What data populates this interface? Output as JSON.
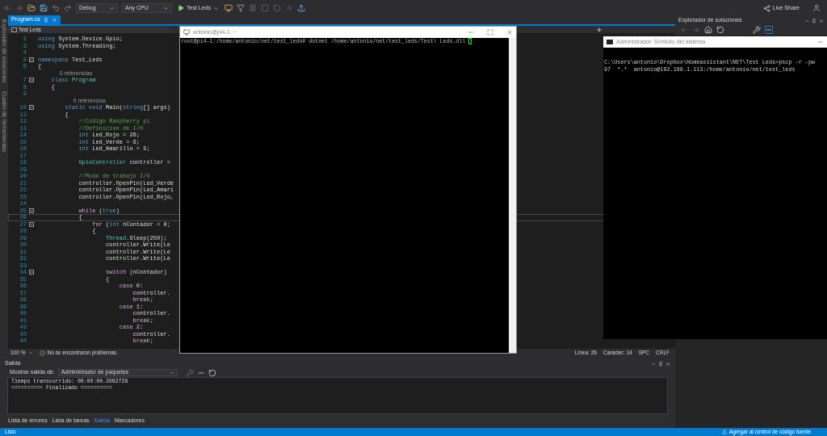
{
  "toolbar": {
    "configuration": "Debug",
    "platform": "Any CPU",
    "run_target": "Test Leds",
    "live_share": "Live Share"
  },
  "side_tabs": [
    {
      "label": "Explorador de soluciones"
    },
    {
      "label": "Cuadro de herramientas"
    }
  ],
  "editor": {
    "tab": {
      "label": "Program.cs",
      "selected": true
    },
    "nav_project": "Test Leds",
    "lines": [
      {
        "kind": "code",
        "number": "2",
        "current": false,
        "fold": false,
        "tokens": [
          {
            "kind": "kw",
            "text": "using"
          },
          {
            "kind": "txt",
            "text": " System.Device.Gpio;"
          }
        ]
      },
      {
        "kind": "code",
        "number": "3",
        "current": false,
        "fold": false,
        "tokens": [
          {
            "kind": "kw",
            "text": "using"
          },
          {
            "kind": "txt",
            "text": " System.Threading;"
          }
        ]
      },
      {
        "kind": "code",
        "number": "4",
        "current": false,
        "fold": false
      },
      {
        "kind": "code",
        "number": "5",
        "current": false,
        "fold": true,
        "tokens": [
          {
            "kind": "kw",
            "text": "namespace"
          },
          {
            "kind": "txt",
            "text": " Test_Leds"
          }
        ]
      },
      {
        "kind": "code",
        "number": "6",
        "current": false,
        "fold": false,
        "tokens": [
          {
            "kind": "txt",
            "text": "{"
          }
        ]
      },
      {
        "kind": "codelens",
        "text": "0 referencias"
      },
      {
        "kind": "code",
        "number": "7",
        "current": false,
        "fold": true,
        "tokens": [
          {
            "kind": "kw",
            "text": "    class"
          },
          {
            "kind": "type",
            "text": " Program"
          }
        ]
      },
      {
        "kind": "code",
        "number": "8",
        "current": false,
        "fold": false,
        "tokens": [
          {
            "kind": "txt",
            "text": "    {"
          }
        ]
      },
      {
        "kind": "code",
        "number": "9",
        "current": false,
        "fold": false
      },
      {
        "kind": "codelens",
        "text": "0 referencias"
      },
      {
        "kind": "code",
        "number": "10",
        "current": false,
        "fold": true,
        "tokens": [
          {
            "kind": "kw",
            "text": "        static void"
          },
          {
            "kind": "txt",
            "text": " Main("
          },
          {
            "kind": "kw",
            "text": "string"
          },
          {
            "kind": "txt",
            "text": "[] args)"
          }
        ]
      },
      {
        "kind": "code",
        "number": "11",
        "current": false,
        "fold": false,
        "tokens": [
          {
            "kind": "txt",
            "text": "        {"
          }
        ]
      },
      {
        "kind": "code",
        "number": "12",
        "current": false,
        "fold": false,
        "tokens": [
          {
            "kind": "cmt",
            "text": "            //Codigo Raspberry pi"
          }
        ]
      },
      {
        "kind": "code",
        "number": "13",
        "current": false,
        "fold": false,
        "tokens": [
          {
            "kind": "cmt",
            "text": "            //Definicion de I/O"
          }
        ]
      },
      {
        "kind": "code",
        "number": "14",
        "current": false,
        "fold": false,
        "tokens": [
          {
            "kind": "kw",
            "text": "            int"
          },
          {
            "kind": "txt",
            "text": " Led_Rojo = 26;"
          }
        ]
      },
      {
        "kind": "code",
        "number": "15",
        "current": false,
        "fold": false,
        "tokens": [
          {
            "kind": "kw",
            "text": "            int"
          },
          {
            "kind": "txt",
            "text": " Led_Verde = 6;"
          }
        ]
      },
      {
        "kind": "code",
        "number": "16",
        "current": false,
        "fold": false,
        "tokens": [
          {
            "kind": "kw",
            "text": "            int"
          },
          {
            "kind": "txt",
            "text": " Led_Amarillo = 5;"
          }
        ]
      },
      {
        "kind": "code",
        "number": "17",
        "current": false,
        "fold": false
      },
      {
        "kind": "code",
        "number": "18",
        "current": false,
        "fold": false,
        "tokens": [
          {
            "kind": "type",
            "text": "            GpioController"
          },
          {
            "kind": "txt",
            "text": " controller ="
          }
        ]
      },
      {
        "kind": "code",
        "number": "19",
        "current": false,
        "fold": false
      },
      {
        "kind": "code",
        "number": "20",
        "current": false,
        "fold": false,
        "tokens": [
          {
            "kind": "cmt",
            "text": "            //Modo de trabajo I/O"
          }
        ]
      },
      {
        "kind": "code",
        "number": "21",
        "current": false,
        "fold": false,
        "tokens": [
          {
            "kind": "txt",
            "text": "            controller.OpenPin(Led_Verde"
          }
        ]
      },
      {
        "kind": "code",
        "number": "22",
        "current": false,
        "fold": false,
        "tokens": [
          {
            "kind": "txt",
            "text": "            controller.OpenPin(Led_Amari"
          }
        ]
      },
      {
        "kind": "code",
        "number": "23",
        "current": false,
        "fold": false,
        "tokens": [
          {
            "kind": "txt",
            "text": "            controller.OpenPin(Led_Rojo,"
          }
        ]
      },
      {
        "kind": "code",
        "number": "24",
        "current": false,
        "fold": false
      },
      {
        "kind": "code",
        "number": "25",
        "current": false,
        "fold": true,
        "tokens": [
          {
            "kind": "ctl",
            "text": "            while"
          },
          {
            "kind": "txt",
            "text": " ("
          },
          {
            "kind": "kw",
            "text": "true"
          },
          {
            "kind": "txt",
            "text": ")"
          }
        ]
      },
      {
        "kind": "code",
        "number": "26",
        "current": true,
        "fold": false,
        "tokens": [
          {
            "kind": "txt",
            "text": "            {"
          }
        ]
      },
      {
        "kind": "code",
        "number": "27",
        "current": false,
        "fold": true,
        "tokens": [
          {
            "kind": "ctl",
            "text": "                for"
          },
          {
            "kind": "txt",
            "text": " ("
          },
          {
            "kind": "kw",
            "text": "int"
          },
          {
            "kind": "txt",
            "text": " nContador = 0;"
          }
        ]
      },
      {
        "kind": "code",
        "number": "28",
        "current": false,
        "fold": false,
        "tokens": [
          {
            "kind": "txt",
            "text": "                {"
          }
        ]
      },
      {
        "kind": "code",
        "number": "29",
        "current": false,
        "fold": false,
        "tokens": [
          {
            "kind": "type",
            "text": "                    Thread"
          },
          {
            "kind": "txt",
            "text": ".Sleep(250);"
          }
        ]
      },
      {
        "kind": "code",
        "number": "30",
        "current": false,
        "fold": false,
        "tokens": [
          {
            "kind": "txt",
            "text": "                    controller.Write(Le"
          }
        ]
      },
      {
        "kind": "code",
        "number": "31",
        "current": false,
        "fold": false,
        "tokens": [
          {
            "kind": "txt",
            "text": "                    controller.Write(Le"
          }
        ]
      },
      {
        "kind": "code",
        "number": "32",
        "current": false,
        "fold": false,
        "tokens": [
          {
            "kind": "txt",
            "text": "                    controller.Write(Le"
          }
        ]
      },
      {
        "kind": "code",
        "number": "33",
        "current": false,
        "fold": false
      },
      {
        "kind": "code",
        "number": "34",
        "current": false,
        "fold": true,
        "tokens": [
          {
            "kind": "ctl",
            "text": "                    switch"
          },
          {
            "kind": "txt",
            "text": " (nContador)"
          }
        ]
      },
      {
        "kind": "code",
        "number": "35",
        "current": false,
        "fold": false,
        "tokens": [
          {
            "kind": "txt",
            "text": "                    {"
          }
        ]
      },
      {
        "kind": "code",
        "number": "36",
        "current": false,
        "fold": false,
        "tokens": [
          {
            "kind": "ctl",
            "text": "                        case"
          },
          {
            "kind": "txt",
            "text": " 0:"
          }
        ]
      },
      {
        "kind": "code",
        "number": "37",
        "current": false,
        "fold": false,
        "tokens": [
          {
            "kind": "txt",
            "text": "                            controller."
          }
        ]
      },
      {
        "kind": "code",
        "number": "38",
        "current": false,
        "fold": false,
        "tokens": [
          {
            "kind": "ctl",
            "text": "                            break"
          },
          {
            "kind": "txt",
            "text": ";"
          }
        ]
      },
      {
        "kind": "code",
        "number": "39",
        "current": false,
        "fold": false,
        "tokens": [
          {
            "kind": "ctl",
            "text": "                        case"
          },
          {
            "kind": "txt",
            "text": " 1:"
          }
        ]
      },
      {
        "kind": "code",
        "number": "40",
        "current": false,
        "fold": false,
        "tokens": [
          {
            "kind": "txt",
            "text": "                            controller."
          }
        ]
      },
      {
        "kind": "code",
        "number": "41",
        "current": false,
        "fold": false,
        "tokens": [
          {
            "kind": "ctl",
            "text": "                            break"
          },
          {
            "kind": "txt",
            "text": ";"
          }
        ]
      },
      {
        "kind": "code",
        "number": "42",
        "current": false,
        "fold": false,
        "tokens": [
          {
            "kind": "ctl",
            "text": "                        case"
          },
          {
            "kind": "txt",
            "text": " 2:"
          }
        ]
      },
      {
        "kind": "code",
        "number": "43",
        "current": false,
        "fold": false,
        "tokens": [
          {
            "kind": "txt",
            "text": "                            controller."
          }
        ]
      },
      {
        "kind": "code",
        "number": "44",
        "current": false,
        "fold": false,
        "tokens": [
          {
            "kind": "ctl",
            "text": "                            break"
          },
          {
            "kind": "txt",
            "text": ";"
          }
        ]
      }
    ],
    "status": {
      "zoom": "100 %",
      "issues": "No se encontraron problemas.",
      "line": "Línea: 26",
      "column": "Carácter: 14",
      "whitespace": "SPC",
      "line_endings": "CRLF"
    }
  },
  "putty": {
    "title": "antonio@pi4-1: ~",
    "prompt": "root@pi4-1:/home/antonio/net/test_leds# dotnet /home/antonio/net/test_leds/Test\\ Leds.dll"
  },
  "cmd": {
    "title": "Administrador: Símbolo del sistema",
    "lines": [
      "C:\\Users\\antonio\\Dropbox\\Homeassistant\\NET\\Test Leds>pscp -r -pw",
      "97  *.*  antonio@192.168.1.113:/home/antonio/net/test_leds"
    ]
  },
  "solution_explorer": {
    "title": "Explorador de soluciones"
  },
  "output": {
    "title": "Salida",
    "source_label": "Mostrar salida de:",
    "source": "Administrador de paquetes",
    "lines": [
      "Tiempo transcurrido: 00:00:00.3062728",
      "========== Finalizado =========="
    ],
    "tabs": [
      {
        "label": "Lista de errores",
        "selected": false
      },
      {
        "label": "Lista de tareas",
        "selected": false
      },
      {
        "label": "Salida",
        "selected": true
      },
      {
        "label": "Marcadores",
        "selected": false
      }
    ]
  },
  "status_bar": {
    "state": "Listo",
    "source_control": "Agregar al control de código fuente"
  }
}
